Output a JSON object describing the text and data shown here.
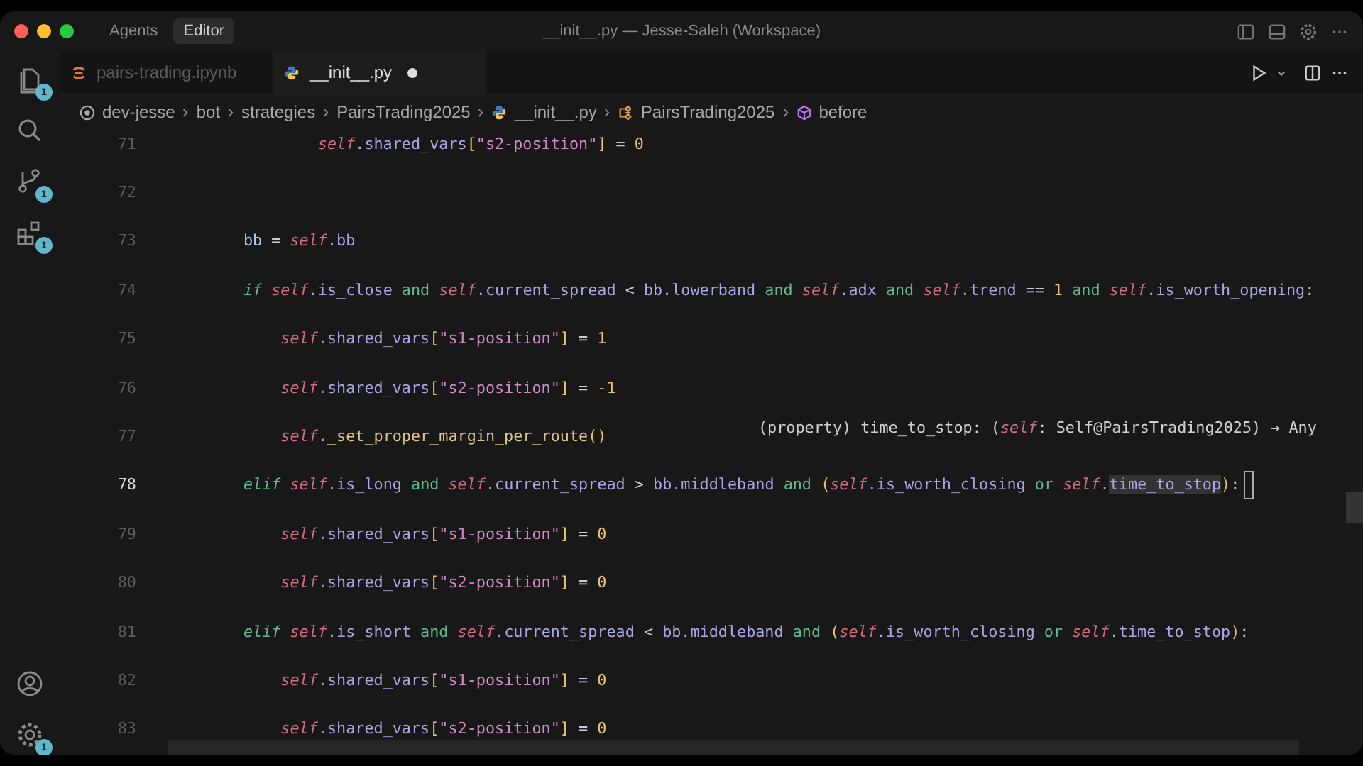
{
  "titlebar": {
    "modes": [
      {
        "label": "Agents",
        "selected": false
      },
      {
        "label": "Editor",
        "selected": true
      }
    ],
    "title": "__init__.py — Jesse-Saleh (Workspace)"
  },
  "activity_bar": {
    "top": [
      {
        "kind": "files",
        "badge": "1"
      },
      {
        "kind": "search"
      },
      {
        "kind": "source-control",
        "badge": "1"
      },
      {
        "kind": "extensions",
        "badge": "1"
      }
    ],
    "bottom": [
      {
        "kind": "account"
      },
      {
        "kind": "settings",
        "badge": "1"
      }
    ]
  },
  "tabs": [
    {
      "label": "pairs-trading.ipynb",
      "kind": "notebook",
      "selected": false,
      "modified": false
    },
    {
      "label": "__init__.py",
      "kind": "python",
      "selected": true,
      "modified": true
    }
  ],
  "breadcrumbs": [
    {
      "label": "dev-jesse",
      "kind": "root"
    },
    {
      "label": "bot",
      "kind": "folder"
    },
    {
      "label": "strategies",
      "kind": "folder"
    },
    {
      "label": "PairsTrading2025",
      "kind": "folder"
    },
    {
      "label": "__init__.py",
      "kind": "python"
    },
    {
      "label": "PairsTrading2025",
      "kind": "class"
    },
    {
      "label": "before",
      "kind": "method"
    }
  ],
  "lines": [
    {
      "number": "71",
      "current": false,
      "tokens": [
        {
          "text": "                self",
          "kind": "self"
        },
        {
          "text": ".shared_vars",
          "kind": "attr"
        },
        {
          "text": "[",
          "kind": "brk"
        },
        {
          "text": "\"s2-position\"",
          "kind": "str"
        },
        {
          "text": "]",
          "kind": "brk"
        },
        {
          "text": " = ",
          "kind": "op"
        },
        {
          "text": "0",
          "kind": "num"
        }
      ]
    },
    {
      "number": "72",
      "current": false
    },
    {
      "number": "73",
      "current": false,
      "tokens": [
        {
          "text": "        bb",
          "kind": "plain"
        },
        {
          "text": " = ",
          "kind": "op"
        },
        {
          "text": "self",
          "kind": "self"
        },
        {
          "text": ".bb",
          "kind": "attr"
        }
      ]
    },
    {
      "number": "74",
      "current": false,
      "tokens": [
        {
          "text": "        if ",
          "kind": "kw"
        },
        {
          "text": "self",
          "kind": "self"
        },
        {
          "text": ".is_close",
          "kind": "attr"
        },
        {
          "text": " and ",
          "kind": "and"
        },
        {
          "text": "self",
          "kind": "self"
        },
        {
          "text": ".current_spread",
          "kind": "attr"
        },
        {
          "text": " < ",
          "kind": "op"
        },
        {
          "text": "bb.lowerband",
          "kind": "attr"
        },
        {
          "text": " and ",
          "kind": "and"
        },
        {
          "text": "self",
          "kind": "self"
        },
        {
          "text": ".adx",
          "kind": "attr"
        },
        {
          "text": " and ",
          "kind": "and"
        },
        {
          "text": "self",
          "kind": "self"
        },
        {
          "text": ".trend",
          "kind": "attr"
        },
        {
          "text": " == ",
          "kind": "op"
        },
        {
          "text": "1",
          "kind": "num"
        },
        {
          "text": " and ",
          "kind": "and"
        },
        {
          "text": "self",
          "kind": "self"
        },
        {
          "text": ".is_worth_opening",
          "kind": "attr"
        },
        {
          "text": ":",
          "kind": "op"
        }
      ]
    },
    {
      "number": "75",
      "current": false,
      "tokens": [
        {
          "text": "            self",
          "kind": "self"
        },
        {
          "text": ".shared_vars",
          "kind": "attr"
        },
        {
          "text": "[",
          "kind": "brk"
        },
        {
          "text": "\"s1-position\"",
          "kind": "str"
        },
        {
          "text": "]",
          "kind": "brk"
        },
        {
          "text": " = ",
          "kind": "op"
        },
        {
          "text": "1",
          "kind": "num"
        }
      ]
    },
    {
      "number": "76",
      "current": false,
      "tokens": [
        {
          "text": "            self",
          "kind": "self"
        },
        {
          "text": ".shared_vars",
          "kind": "attr"
        },
        {
          "text": "[",
          "kind": "brk"
        },
        {
          "text": "\"s2-position\"",
          "kind": "str"
        },
        {
          "text": "]",
          "kind": "brk"
        },
        {
          "text": " = ",
          "kind": "op"
        },
        {
          "text": "-1",
          "kind": "num"
        }
      ]
    },
    {
      "number": "77",
      "current": false,
      "tokens": [
        {
          "text": "            self",
          "kind": "self"
        },
        {
          "text": "._set_proper_margin_per_route",
          "kind": "fn"
        },
        {
          "text": "()",
          "kind": "brk"
        }
      ]
    },
    {
      "number": "78",
      "current": true,
      "tokens": [
        {
          "text": "        elif ",
          "kind": "kw"
        },
        {
          "text": "self",
          "kind": "self"
        },
        {
          "text": ".is_long",
          "kind": "attr"
        },
        {
          "text": " and ",
          "kind": "and"
        },
        {
          "text": "self",
          "kind": "self"
        },
        {
          "text": ".current_spread",
          "kind": "attr"
        },
        {
          "text": " > ",
          "kind": "op"
        },
        {
          "text": "bb.middleband",
          "kind": "attr"
        },
        {
          "text": " and ",
          "kind": "and"
        },
        {
          "text": "(",
          "kind": "brk"
        },
        {
          "text": "self",
          "kind": "self"
        },
        {
          "text": ".is_worth_closing",
          "kind": "attr"
        },
        {
          "text": " or ",
          "kind": "and"
        },
        {
          "text": "self",
          "kind": "self"
        },
        {
          "text": ".",
          "kind": "attr"
        },
        {
          "text": "time_to_stop",
          "kind": "hl"
        },
        {
          "text": ")",
          "kind": "brk"
        },
        {
          "text": ":",
          "kind": "op"
        }
      ]
    },
    {
      "number": "79",
      "current": false,
      "tokens": [
        {
          "text": "            self",
          "kind": "self"
        },
        {
          "text": ".shared_vars",
          "kind": "attr"
        },
        {
          "text": "[",
          "kind": "brk"
        },
        {
          "text": "\"s1-position\"",
          "kind": "str"
        },
        {
          "text": "]",
          "kind": "brk"
        },
        {
          "text": " = ",
          "kind": "op"
        },
        {
          "text": "0",
          "kind": "num"
        }
      ]
    },
    {
      "number": "80",
      "current": false,
      "tokens": [
        {
          "text": "            self",
          "kind": "self"
        },
        {
          "text": ".shared_vars",
          "kind": "attr"
        },
        {
          "text": "[",
          "kind": "brk"
        },
        {
          "text": "\"s2-position\"",
          "kind": "str"
        },
        {
          "text": "]",
          "kind": "brk"
        },
        {
          "text": " = ",
          "kind": "op"
        },
        {
          "text": "0",
          "kind": "num"
        }
      ]
    },
    {
      "number": "81",
      "current": false,
      "tokens": [
        {
          "text": "        elif ",
          "kind": "kw"
        },
        {
          "text": "self",
          "kind": "self"
        },
        {
          "text": ".is_short",
          "kind": "attr"
        },
        {
          "text": " and ",
          "kind": "and"
        },
        {
          "text": "self",
          "kind": "self"
        },
        {
          "text": ".current_spread",
          "kind": "attr"
        },
        {
          "text": " < ",
          "kind": "op"
        },
        {
          "text": "bb.middleband",
          "kind": "attr"
        },
        {
          "text": " and ",
          "kind": "and"
        },
        {
          "text": "(",
          "kind": "brk"
        },
        {
          "text": "self",
          "kind": "self"
        },
        {
          "text": ".is_worth_closing",
          "kind": "attr"
        },
        {
          "text": " or ",
          "kind": "and"
        },
        {
          "text": "self",
          "kind": "self"
        },
        {
          "text": ".time_to_stop",
          "kind": "attr"
        },
        {
          "text": ")",
          "kind": "brk"
        },
        {
          "text": ":",
          "kind": "op"
        }
      ]
    },
    {
      "number": "82",
      "current": false,
      "tokens": [
        {
          "text": "            self",
          "kind": "self"
        },
        {
          "text": ".shared_vars",
          "kind": "attr"
        },
        {
          "text": "[",
          "kind": "brk"
        },
        {
          "text": "\"s1-position\"",
          "kind": "str"
        },
        {
          "text": "]",
          "kind": "brk"
        },
        {
          "text": " = ",
          "kind": "op"
        },
        {
          "text": "0",
          "kind": "num"
        }
      ]
    },
    {
      "number": "83",
      "current": false,
      "tokens": [
        {
          "text": "            self",
          "kind": "self"
        },
        {
          "text": ".shared_vars",
          "kind": "attr"
        },
        {
          "text": "[",
          "kind": "brk"
        },
        {
          "text": "\"s2-position\"",
          "kind": "str"
        },
        {
          "text": "]",
          "kind": "brk"
        },
        {
          "text": " = ",
          "kind": "op"
        },
        {
          "text": "0",
          "kind": "num"
        }
      ]
    }
  ],
  "hover": {
    "tokens": [
      {
        "text": "(property) time_to_stop: (",
        "kind": "plain"
      },
      {
        "text": "self",
        "kind": "self"
      },
      {
        "text": ": Self@PairsTrading2025) → Any",
        "kind": "plain"
      }
    ]
  }
}
